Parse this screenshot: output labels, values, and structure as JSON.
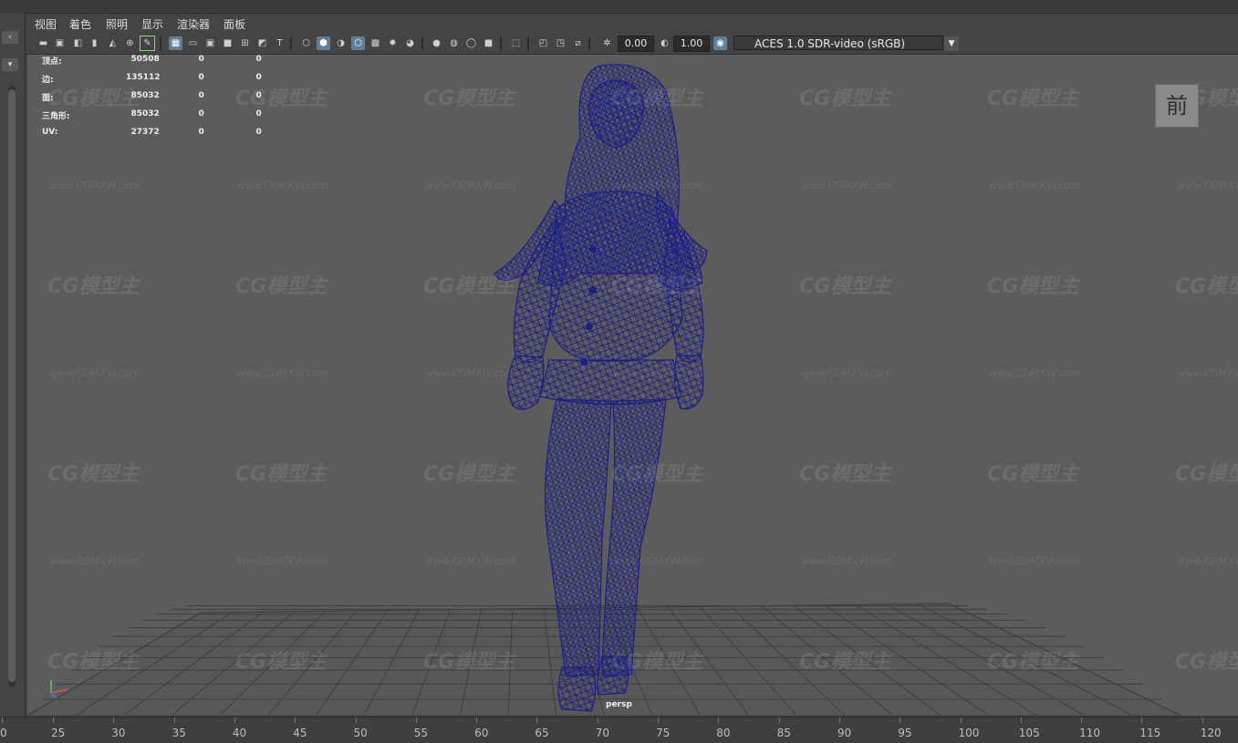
{
  "menu": {
    "items": [
      "视图",
      "着色",
      "照明",
      "显示",
      "渲染器",
      "面板"
    ]
  },
  "toolbar": {
    "exposure_value": "0.00",
    "gamma_value": "1.00",
    "color_space": "ACES 1.0 SDR-video (sRGB)"
  },
  "hud": {
    "rows": [
      {
        "label": "顶点:",
        "values": [
          "50508",
          "0",
          "0"
        ]
      },
      {
        "label": "边:",
        "values": [
          "135112",
          "0",
          "0"
        ]
      },
      {
        "label": "面:",
        "values": [
          "85032",
          "0",
          "0"
        ]
      },
      {
        "label": "三角形:",
        "values": [
          "85032",
          "0",
          "0"
        ]
      },
      {
        "label": "UV:",
        "values": [
          "27372",
          "0",
          "0"
        ]
      }
    ]
  },
  "viewport": {
    "camera_label": "persp",
    "view_cube_label": "前",
    "wireframe_color": "#1c1f86",
    "background_color": "#5c5c5c"
  },
  "watermark": {
    "logo_text": "CG模型主",
    "url_text": "www.CGMXW.com"
  },
  "timeline": {
    "ticks": [
      "0",
      "25",
      "30",
      "35",
      "40",
      "45",
      "50",
      "55",
      "60",
      "65",
      "70",
      "75",
      "80",
      "85",
      "90",
      "95",
      "100",
      "105",
      "110",
      "115",
      "120"
    ]
  }
}
